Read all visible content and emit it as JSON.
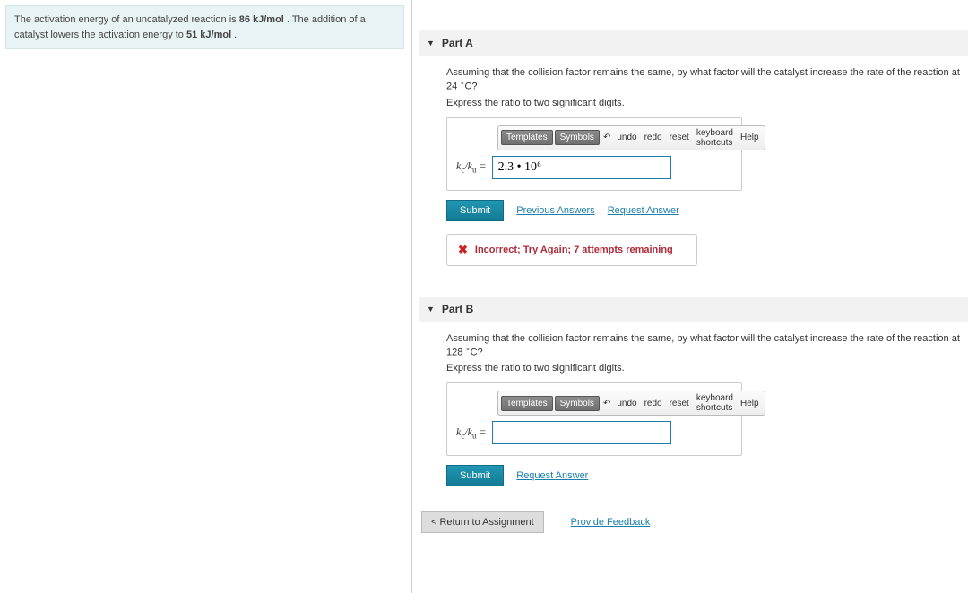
{
  "problem": {
    "pre": "The activation energy of an uncatalyzed reaction is ",
    "val1": "86 kJ/mol",
    "mid": " . The addition of a catalyst lowers the activation energy to ",
    "val2": "51 kJ/mol",
    "post": " ."
  },
  "partA": {
    "title": "Part A",
    "question_pre": "Assuming that the collision factor remains the same, by what factor will the catalyst increase the rate of the reaction at 24 ",
    "question_post": "C?",
    "instruction": "Express the ratio to two significant digits.",
    "answer_value_display": "2.3 • 10⁶",
    "submit": "Submit",
    "prev_answers": "Previous Answers",
    "request_answer": "Request Answer",
    "feedback": "Incorrect; Try Again; 7 attempts remaining"
  },
  "partB": {
    "title": "Part B",
    "question_pre": "Assuming that the collision factor remains the same, by what factor will the catalyst increase the rate of the reaction at 128 ",
    "question_post": "C?",
    "instruction": "Express the ratio to two significant digits.",
    "answer_value_display": "",
    "submit": "Submit",
    "request_answer": "Request Answer"
  },
  "toolbar": {
    "templates": "Templates",
    "symbols": "Symbols",
    "undo": "undo",
    "redo": "redo",
    "reset": "reset",
    "keyboard": "keyboard shortcuts",
    "help": "Help"
  },
  "footer": {
    "return": "Return to Assignment",
    "feedback": "Provide Feedback"
  },
  "ratio_label": "k_c/k_u ="
}
